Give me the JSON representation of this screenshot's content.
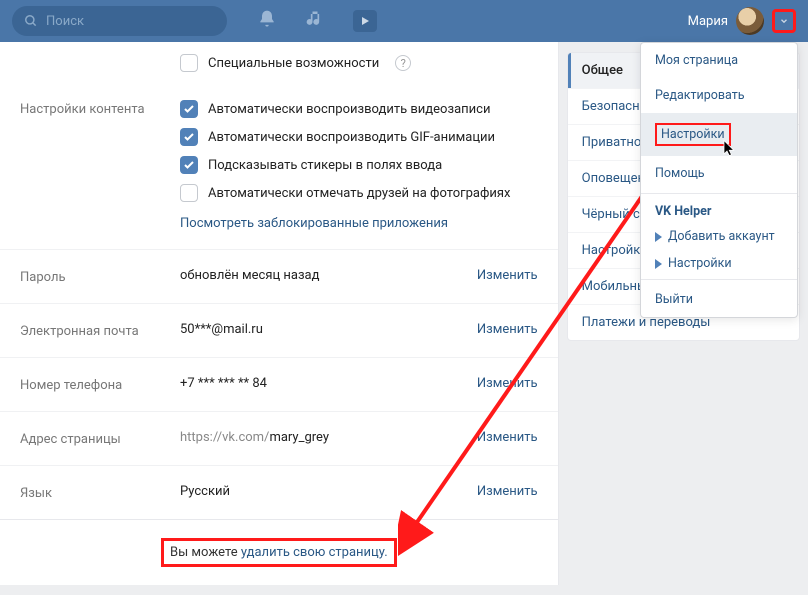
{
  "topbar": {
    "search_placeholder": "Поиск",
    "username": "Мария"
  },
  "accessibility": {
    "label": "Специальные возможности"
  },
  "content_settings": {
    "label": "Настройки контента",
    "autoplay_video": "Автоматически воспроизводить видеозаписи",
    "autoplay_gif": "Автоматически воспроизводить GIF-анимации",
    "suggest_stickers": "Подсказывать стикеры в полях ввода",
    "auto_tag": "Автоматически отмечать друзей на фотографиях",
    "blocked_apps": "Посмотреть заблокированные приложения"
  },
  "password": {
    "label": "Пароль",
    "value": "обновлён месяц назад",
    "action": "Изменить"
  },
  "email": {
    "label": "Электронная почта",
    "value": "50***@mail.ru",
    "action": "Изменить"
  },
  "phone": {
    "label": "Номер телефона",
    "value": "+7 *** *** ** 84",
    "action": "Изменить"
  },
  "address": {
    "label": "Адрес страницы",
    "value_prefix": "https://vk.com/",
    "value_user": "mary_grey",
    "action": "Изменить"
  },
  "language": {
    "label": "Язык",
    "value": "Русский",
    "action": "Изменить"
  },
  "footer": {
    "text": "Вы можете ",
    "link": "удалить свою страницу."
  },
  "side_tabs": [
    "Общее",
    "Безопасность",
    "Приватность",
    "Оповещения",
    "Чёрный список",
    "Настройки приложений",
    "Мобильные сервисы",
    "Платежи и переводы"
  ],
  "dropdown": {
    "my_page": "Моя страница",
    "edit": "Редактировать",
    "settings": "Настройки",
    "help": "Помощь",
    "helper_header": "VK Helper",
    "add_account": "Добавить аккаунт",
    "helper_settings": "Настройки",
    "logout": "Выйти"
  }
}
